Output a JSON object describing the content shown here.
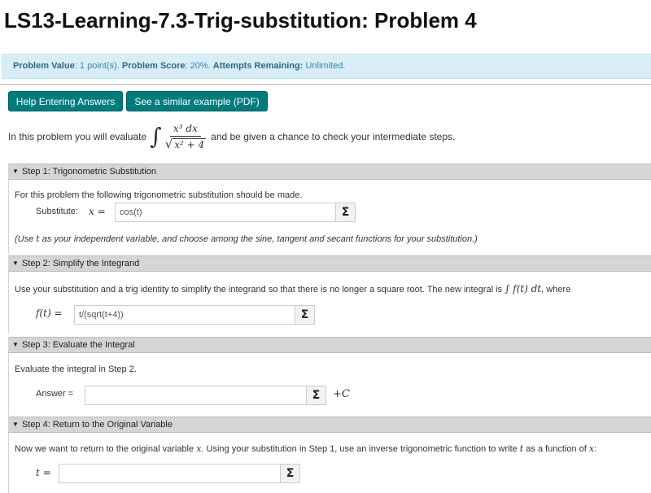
{
  "page": {
    "title": "LS13-Learning-7.3-Trig-substitution: Problem 4"
  },
  "info": {
    "value_label": "Problem Value",
    "value_text": ": 1 point(s). ",
    "score_label": "Problem Score",
    "score_text": ": 20%. ",
    "attempts_label": "Attempts Remaining:",
    "attempts_text": " Unlimited."
  },
  "buttons": {
    "help": "Help Entering Answers",
    "example": "See a similar example (PDF)"
  },
  "intro": {
    "before": "In this problem you will evaluate",
    "integral_sign": "∫",
    "numerator": "x³ dx",
    "radical": "√",
    "denominator": "x² + 4",
    "after": "and be given a chance to check your intermediate steps."
  },
  "steps": {
    "s1": {
      "header": "Step 1: Trigonometric Substitution",
      "desc": "For this problem the following trigonometric substitution should be made.",
      "sub_label": "Substitute:",
      "sub_var": "x =",
      "value": "cos(t)",
      "note_before": "(Use ",
      "note_var": "t",
      "note_after": " as your independent variable, and choose among the sine, tangent and secant functions for your substitution.)"
    },
    "s2": {
      "header": "Step 2: Simplify the Integrand",
      "desc": "Use your substitution and a trig identity to simplify the integrand so that there is no longer a square root. The new integral is",
      "desc_math": "∫ f(t) dt",
      "desc_end": ", where",
      "var_label": "f(t) =",
      "value": "t/(sqrt(t+4))"
    },
    "s3": {
      "header": "Step 3: Evaluate the Integral",
      "desc": "Evaluate the integral in Step 2.",
      "answer_label": "Answer =",
      "value": "",
      "plus_c": "+C"
    },
    "s4": {
      "header": "Step 4: Return to the Original Variable",
      "desc_before": "Now we want to return to the original variable",
      "desc_var": "x",
      "desc_mid": ". Using your substitution in Step 1, use an inverse trigonometric function to write",
      "desc_var2": "t",
      "desc_mid2": "as a function of",
      "desc_var3": "x",
      "desc_end": ":",
      "var_label": "t =",
      "value": ""
    }
  },
  "icons": {
    "sigma": "Σ",
    "collapse": "▼"
  },
  "colors": {
    "button_bg": "#007c7d",
    "info_bg": "#d9edf7",
    "info_text": "#3a87ad",
    "section_bg": "#d5d5d5"
  }
}
